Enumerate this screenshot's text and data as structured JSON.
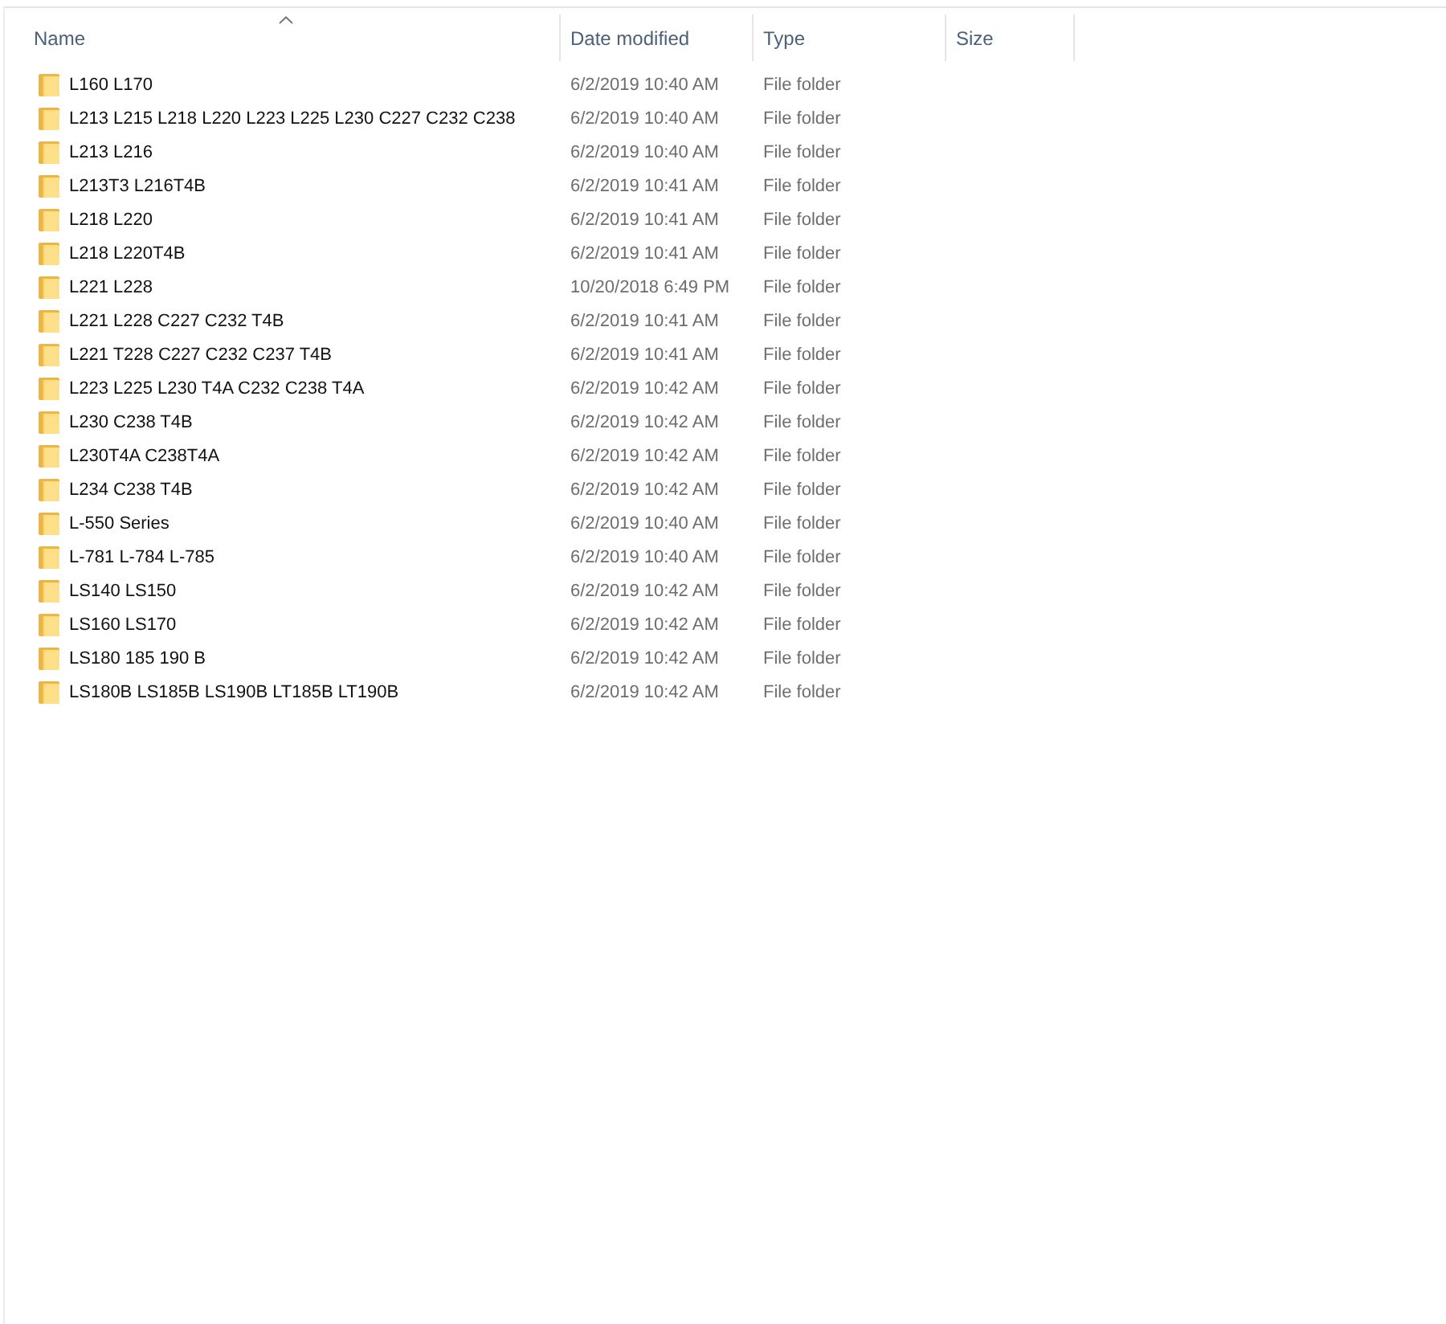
{
  "columns": [
    {
      "label": "Name",
      "sorted": true
    },
    {
      "label": "Date modified",
      "sorted": false
    },
    {
      "label": "Type",
      "sorted": false
    },
    {
      "label": "Size",
      "sorted": false
    }
  ],
  "rows": [
    {
      "name": "L160 L170",
      "date_modified": "6/2/2019 10:40 AM",
      "type": "File folder"
    },
    {
      "name": "L213 L215 L218 L220 L223 L225 L230 C227 C232 C238",
      "date_modified": "6/2/2019 10:40 AM",
      "type": "File folder"
    },
    {
      "name": "L213 L216",
      "date_modified": "6/2/2019 10:40 AM",
      "type": "File folder"
    },
    {
      "name": "L213T3 L216T4B",
      "date_modified": "6/2/2019 10:41 AM",
      "type": "File folder"
    },
    {
      "name": "L218 L220",
      "date_modified": "6/2/2019 10:41 AM",
      "type": "File folder"
    },
    {
      "name": "L218 L220T4B",
      "date_modified": "6/2/2019 10:41 AM",
      "type": "File folder"
    },
    {
      "name": "L221 L228",
      "date_modified": "10/20/2018 6:49 PM",
      "type": "File folder"
    },
    {
      "name": "L221 L228 C227 C232 T4B",
      "date_modified": "6/2/2019 10:41 AM",
      "type": "File folder"
    },
    {
      "name": "L221 T228 C227 C232 C237 T4B",
      "date_modified": "6/2/2019 10:41 AM",
      "type": "File folder"
    },
    {
      "name": "L223 L225 L230 T4A C232 C238 T4A",
      "date_modified": "6/2/2019 10:42 AM",
      "type": "File folder"
    },
    {
      "name": "L230 C238 T4B",
      "date_modified": "6/2/2019 10:42 AM",
      "type": "File folder"
    },
    {
      "name": "L230T4A C238T4A",
      "date_modified": "6/2/2019 10:42 AM",
      "type": "File folder"
    },
    {
      "name": "L234 C238 T4B",
      "date_modified": "6/2/2019 10:42 AM",
      "type": "File folder"
    },
    {
      "name": "L-550 Series",
      "date_modified": "6/2/2019 10:40 AM",
      "type": "File folder"
    },
    {
      "name": "L-781 L-784 L-785",
      "date_modified": "6/2/2019 10:40 AM",
      "type": "File folder"
    },
    {
      "name": "LS140 LS150",
      "date_modified": "6/2/2019 10:42 AM",
      "type": "File folder"
    },
    {
      "name": "LS160 LS170",
      "date_modified": "6/2/2019 10:42 AM",
      "type": "File folder"
    },
    {
      "name": "LS180 185 190 B",
      "date_modified": "6/2/2019 10:42 AM",
      "type": "File folder"
    },
    {
      "name": "LS180B LS185B LS190B LT185B LT190B",
      "date_modified": "6/2/2019 10:42 AM",
      "type": "File folder"
    }
  ]
}
